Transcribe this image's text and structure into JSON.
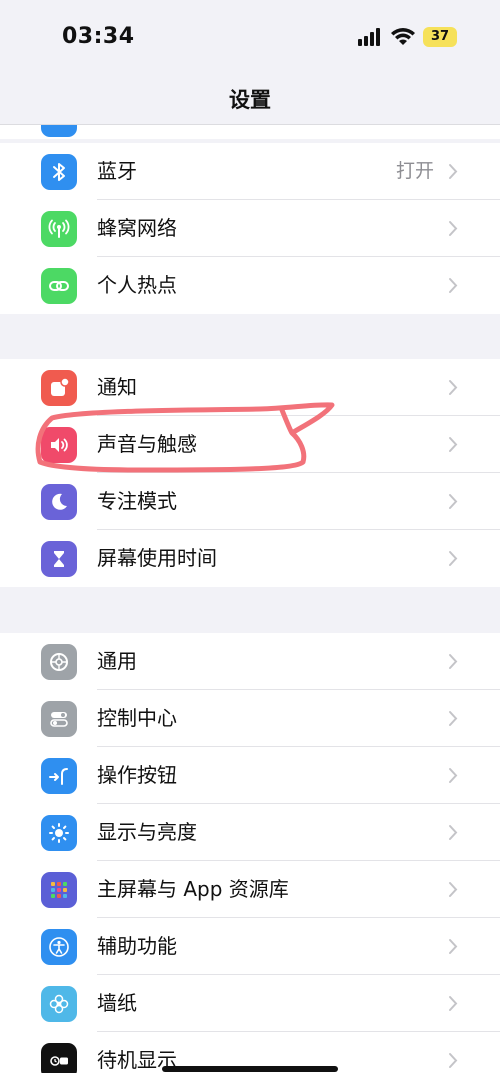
{
  "status_bar": {
    "time": "03:34",
    "battery": "37"
  },
  "nav": {
    "title": "设置"
  },
  "colors": {
    "bluetooth": "#2f8ff0",
    "cellular": "#4cd964",
    "hotspot": "#4cd964",
    "notifications": "#f05b4f",
    "sounds": "#f04a6a",
    "focus": "#6a63d8",
    "screen_time": "#6a63d8",
    "general": "#9ea3a8",
    "control_center": "#9ea3a8",
    "action_button": "#2f8ff0",
    "display": "#2f8ff0",
    "home_screen": "#5b5fd6",
    "accessibility": "#2f8ff0",
    "wallpaper": "#4fb8e8",
    "standby": "#111111",
    "annotation": "#f2727a"
  },
  "group1": {
    "items": [
      {
        "label": "蓝牙",
        "value": "打开",
        "icon": "bluetooth-icon"
      },
      {
        "label": "蜂窝网络",
        "icon": "cellular-icon"
      },
      {
        "label": "个人热点",
        "icon": "hotspot-icon"
      }
    ]
  },
  "group2": {
    "items": [
      {
        "label": "通知",
        "icon": "notifications-icon"
      },
      {
        "label": "声音与触感",
        "icon": "speaker-icon"
      },
      {
        "label": "专注模式",
        "icon": "moon-icon"
      },
      {
        "label": "屏幕使用时间",
        "icon": "hourglass-icon"
      }
    ]
  },
  "group3": {
    "items": [
      {
        "label": "通用",
        "icon": "gear-icon"
      },
      {
        "label": "控制中心",
        "icon": "toggles-icon"
      },
      {
        "label": "操作按钮",
        "icon": "action-button-icon"
      },
      {
        "label": "显示与亮度",
        "icon": "sun-icon"
      },
      {
        "label": "主屏幕与 App 资源库",
        "icon": "app-grid-icon"
      },
      {
        "label": "辅助功能",
        "icon": "accessibility-icon"
      },
      {
        "label": "墙纸",
        "icon": "flower-icon"
      },
      {
        "label": "待机显示",
        "icon": "standby-icon"
      }
    ]
  }
}
